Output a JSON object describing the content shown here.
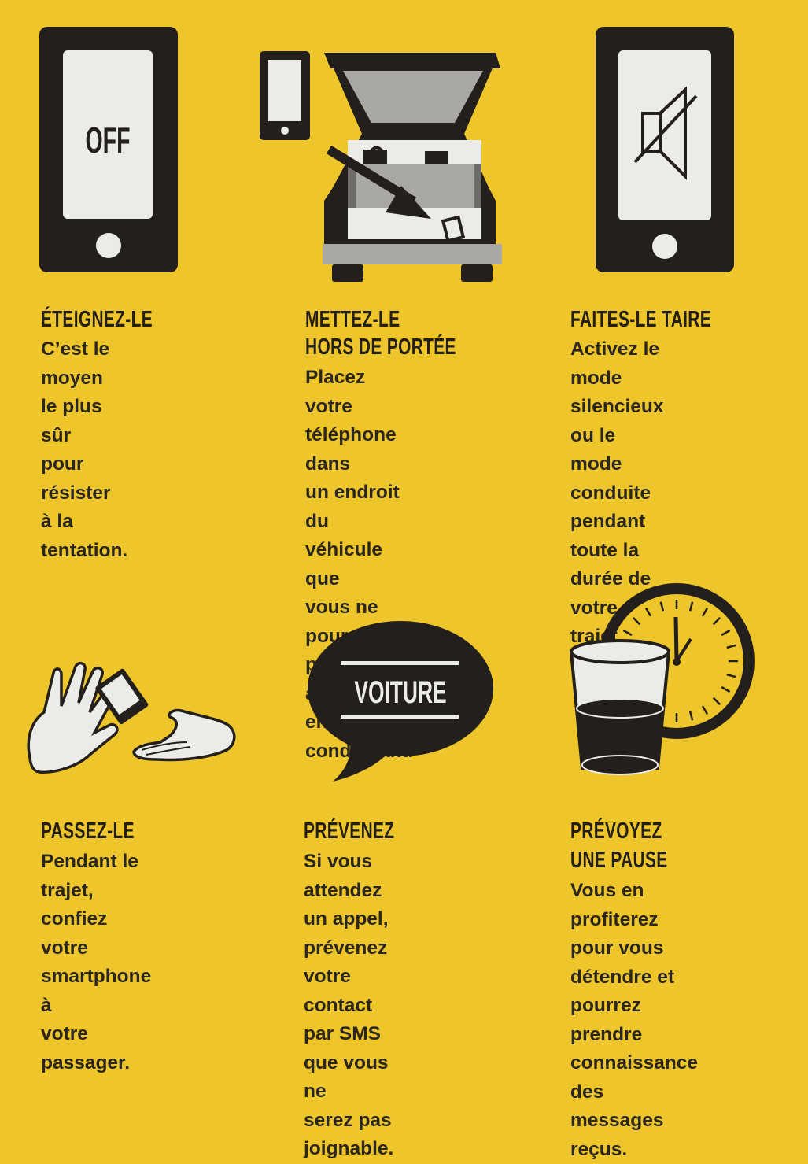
{
  "colors": {
    "background": "#eec52a",
    "ink": "#231f1c",
    "screen": "#ebebe8",
    "grey": "#a9a8a4"
  },
  "tips": [
    {
      "icon": "phone-off-icon",
      "icon_text": "OFF",
      "title": "ÉTEIGNEZ-LE",
      "body": "C’est le moyen\nle plus sûr\npour résister\nà la tentation."
    },
    {
      "icon": "phone-in-car-trunk-icon",
      "title_lines": [
        "METTEZ-LE",
        "HORS DE PORTÉE"
      ],
      "body": "Placez votre\ntéléphone dans\nun endroit du\nvéhicule que\nvous ne pourrez\npas atteindre en\nconduisant."
    },
    {
      "icon": "phone-muted-speaker-icon",
      "title": "FAITES-LE TAIRE",
      "body": "Activez le mode\nsilencieux ou le\nmode conduite\npendant toute la\ndurée de votre\ntrajet."
    },
    {
      "icon": "hands-passing-phone-icon",
      "title": "PASSEZ-LE",
      "body": "Pendant le trajet,\nconfiez votre\nsmartphone à\nvotre passager."
    },
    {
      "icon": "speech-bubble-icon",
      "icon_text": "VOITURE",
      "title": "PRÉVENEZ",
      "body": "Si vous attendez\nun appel,\nprévenez votre\ncontact par SMS\nque vous ne\nserez pas\njoignable."
    },
    {
      "icon": "clock-and-glass-icon",
      "title_lines": [
        "PRÉVOYEZ",
        "UNE PAUSE"
      ],
      "body": "Vous en profiterez\npour vous\ndétendre et\npourrez prendre\nconnaissance des\nmessages reçus."
    }
  ]
}
